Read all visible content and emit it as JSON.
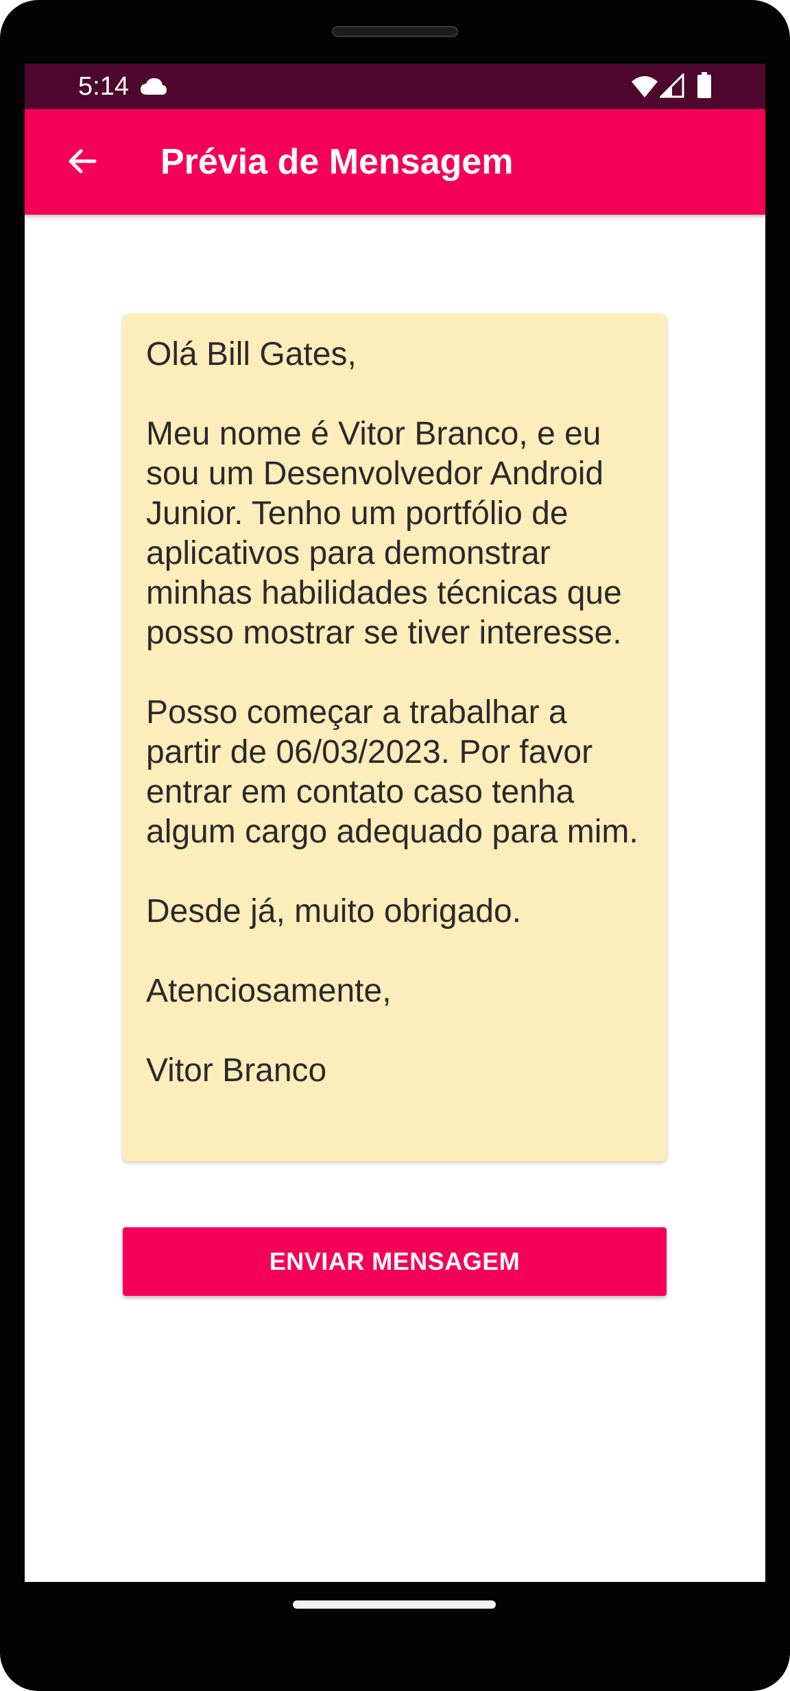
{
  "status_bar": {
    "time": "5:14",
    "icons": [
      "cloud-icon",
      "wifi-icon",
      "signal-icon",
      "battery-icon"
    ]
  },
  "app_bar": {
    "back_icon": "arrow-back-icon",
    "title": "Prévia de Mensagem"
  },
  "message": {
    "text": "Olá Bill Gates,\n\nMeu nome é Vitor Branco, e eu sou um Desenvolvedor Android Junior. Tenho um portfólio de aplicativos para demonstrar minhas habilidades técnicas que posso mostrar se tiver interesse.\n\nPosso começar a trabalhar a partir de 06/03/2023. Por favor entrar em contato caso tenha algum cargo adequado para mim.\n\nDesde já, muito obrigado.\n\nAtenciosamente,\n\nVitor Branco"
  },
  "actions": {
    "send_label": "ENVIAR MENSAGEM"
  },
  "colors": {
    "primary": "#f50057",
    "status_bar": "#4e072d",
    "card_background": "#fdedbb"
  }
}
